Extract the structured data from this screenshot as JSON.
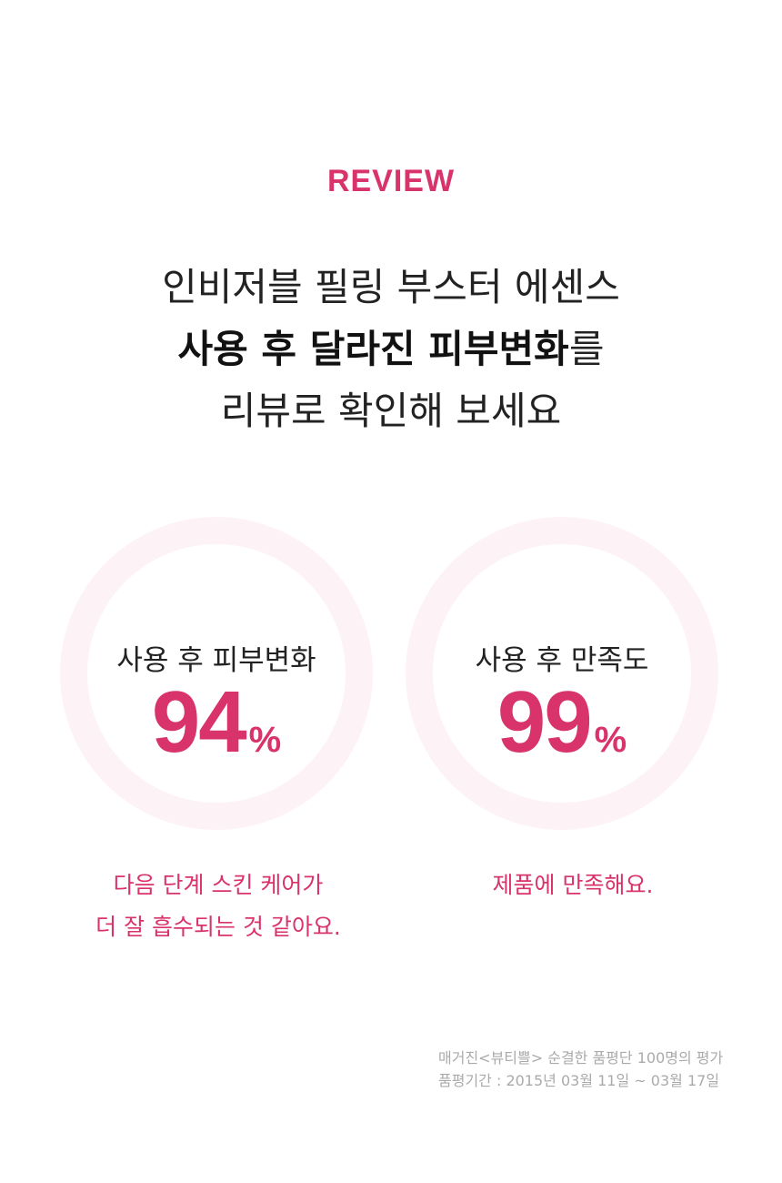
{
  "section": {
    "label": "REVIEW"
  },
  "headline": {
    "line1": "인비저블 필링 부스터 에센스",
    "line2_strong": "사용 후 달라진 피부변화",
    "line2_rest": "를",
    "line3": "리뷰로 확인해 보세요"
  },
  "stats": [
    {
      "title": "사용 후 피부변화",
      "value": "94",
      "unit": "%",
      "comment_lines": [
        "다음 단계 스킨 케어가",
        "더 잘 흡수되는 것 같아요."
      ]
    },
    {
      "title": "사용 후 만족도",
      "value": "99",
      "unit": "%",
      "comment_lines": [
        "제품에 만족해요."
      ]
    }
  ],
  "source": {
    "line1": "매거진<뷰티쁠> 순결한 품평단 100명의 평가",
    "line2": "품평기간 : 2015년 03월 11일 ~ 03월 17일"
  },
  "colors": {
    "accent": "#d9336b",
    "ring": "#fdf3f6",
    "text": "#222222",
    "muted": "#aaaaaa"
  }
}
